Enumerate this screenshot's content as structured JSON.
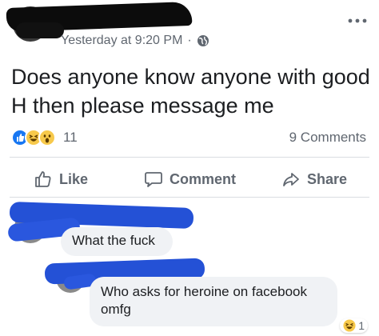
{
  "post": {
    "timestamp": "Yesterday at 9:20 PM",
    "separator": "·",
    "text": "Does anyone know anyone with good H then please message me",
    "reaction_count": "11",
    "comments_count": "9 Comments"
  },
  "actions": {
    "like": "Like",
    "comment": "Comment",
    "share": "Share"
  },
  "comments": [
    {
      "text": "What the fuck"
    },
    {
      "text": "Who asks for heroine on facebook omfg"
    }
  ],
  "comment_reaction": {
    "count": "1"
  },
  "colors": {
    "accent": "#1877f2",
    "text_secondary": "#606770",
    "bubble": "#f0f2f5",
    "redaction_blue": "#2451d6"
  },
  "icons": [
    "globe-icon",
    "more-options-icon",
    "like-icon",
    "comment-icon",
    "share-icon",
    "haha-reaction-icon",
    "wow-reaction-icon",
    "like-reaction-icon"
  ]
}
